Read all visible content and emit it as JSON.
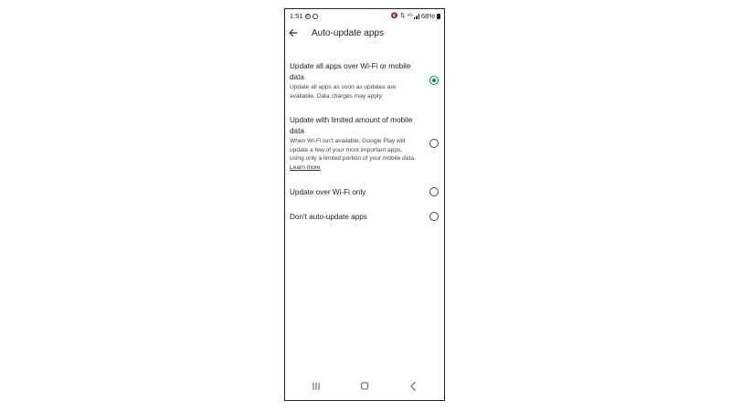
{
  "status_bar": {
    "time": "1:51",
    "battery": "68%",
    "left_icons": [
      "phone-call-icon",
      "instagram-icon"
    ],
    "right_icons": [
      "mute-icon",
      "wifi-data-icon",
      "lte-icon",
      "signal-icon",
      "battery-icon"
    ]
  },
  "appbar": {
    "title": "Auto-update apps",
    "back_icon": "arrow-left-icon"
  },
  "options": [
    {
      "title": "Update all apps over Wi-Fi or mobile data",
      "description": "Update all apps as soon as updates are available. Data charges may apply.",
      "selected": true
    },
    {
      "title": "Update with limited amount of mobile data",
      "description": "When Wi-Fi isn't available, Google Play will update a few of your most important apps, using only a limited portion of your mobile data.",
      "link": "Learn more",
      "selected": false
    },
    {
      "title": "Update over Wi-Fi only",
      "selected": false
    },
    {
      "title": "Don't auto-update apps",
      "selected": false
    }
  ],
  "colors": {
    "accent": "#01875f",
    "text": "#1f1f1f",
    "secondary_text": "#444444"
  },
  "nav_bar": {
    "icons": [
      "recents-icon",
      "home-icon",
      "back-nav-icon"
    ]
  }
}
